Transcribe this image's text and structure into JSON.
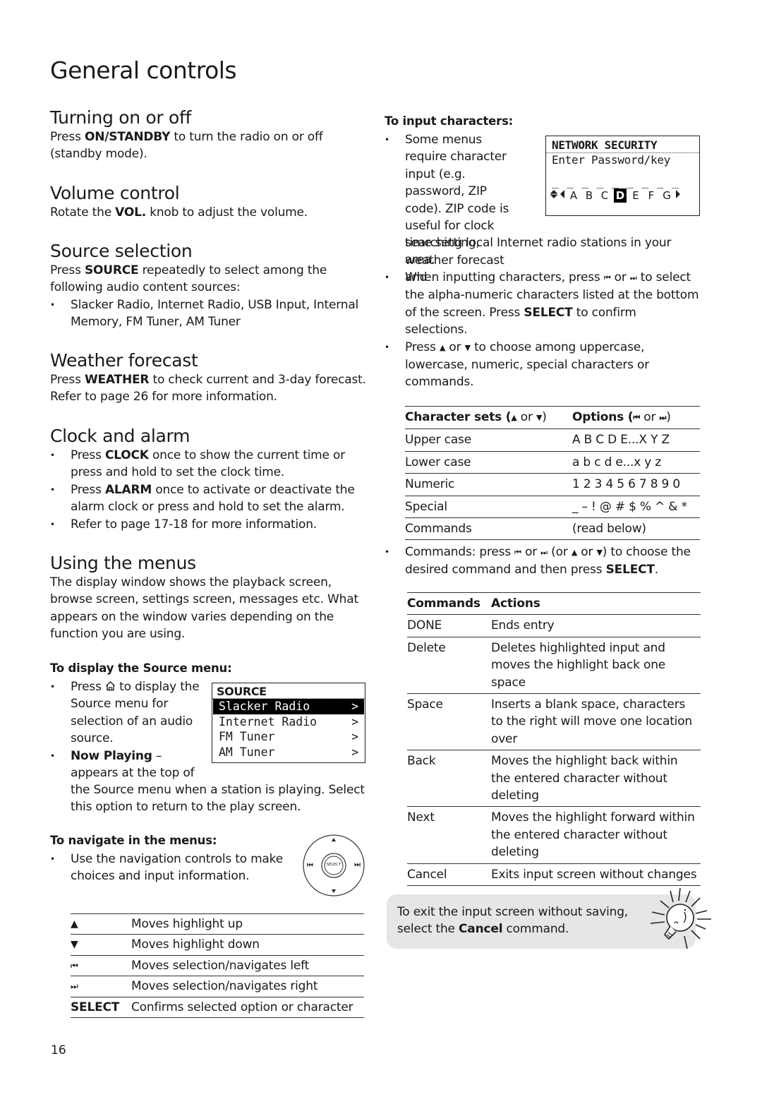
{
  "page": {
    "title": "General controls",
    "page_number": "16"
  },
  "left": {
    "turning": {
      "heading": "Turning on or off",
      "pre": "Press ",
      "key": "ON/STANDBY",
      "post": " to turn the radio on or off (standby mode)."
    },
    "volume": {
      "heading": "Volume control",
      "pre": "Rotate the ",
      "key": "VOL.",
      "post": " knob to adjust the volume."
    },
    "source": {
      "heading": "Source selection",
      "pre": "Press ",
      "key": "SOURCE",
      "post": " repeatedly to select among the following audio content sources:",
      "bullet": "Slacker Radio, Internet Radio, USB Input, Internal Memory, FM Tuner, AM Tuner"
    },
    "weather": {
      "heading": "Weather forecast",
      "pre": "Press ",
      "key": "WEATHER",
      "post": " to check current and 3-day forecast. Refer to page 26 for more information."
    },
    "clock": {
      "heading": "Clock and alarm",
      "bullets": [
        {
          "pre": "Press ",
          "key": "CLOCK",
          "post": " once to show the current time or press and hold to set the clock time."
        },
        {
          "pre": "Press ",
          "key": "ALARM",
          "post": " once to activate or deactivate the alarm clock or press and hold to set the alarm."
        },
        {
          "pre": "Refer to page 17-18 for more information.",
          "key": "",
          "post": ""
        }
      ]
    },
    "menus": {
      "heading": "Using the menus",
      "body": "The display window shows the playback screen, browse screen, settings screen, messages etc. What appears on the window varies depending on the function you are using.",
      "source_menu_heading": "To display the Source menu:",
      "source_bullet_pre": "Press ",
      "source_bullet_post": " to display the Source menu for selection of an audio source.",
      "now_playing_key": "Now Playing",
      "now_playing_text": " – appears at the top of the Source menu when a station is playing. Select this option to return to the play screen.",
      "lcd": {
        "title": "SOURCE",
        "items": [
          {
            "label": "Slacker Radio",
            "arrow": ">",
            "selected": true
          },
          {
            "label": "Internet Radio",
            "arrow": ">",
            "selected": false
          },
          {
            "label": "FM Tuner",
            "arrow": ">",
            "selected": false
          },
          {
            "label": "AM Tuner",
            "arrow": ">",
            "selected": false
          }
        ]
      },
      "navigate_heading": "To navigate in the menus:",
      "navigate_bullet": "Use the navigation controls to make choices and input information.",
      "dial_center_label": "SELECT",
      "controls": [
        {
          "key": "▲",
          "icon": "up-triangle-icon",
          "action": "Moves highlight up"
        },
        {
          "key": "▼",
          "icon": "down-triangle-icon",
          "action": "Moves highlight down"
        },
        {
          "key": "⏮",
          "icon": "skip-back-icon",
          "action": "Moves selection/navigates left"
        },
        {
          "key": "⏭",
          "icon": "skip-forward-icon",
          "action": "Moves selection/navigates right"
        },
        {
          "key": "SELECT",
          "icon": "",
          "action": "Confirms selected option or character"
        }
      ]
    }
  },
  "right": {
    "input_heading": "To input characters:",
    "bullet1": "Some menus require character input (e.g. password, ZIP code). ZIP code is useful for clock time setting, weather forecast and searching local Internet radio stations in your area.",
    "lcd": {
      "title": "NETWORK SECURITY",
      "line2": "Enter Password/key",
      "blanks": "_ _ _ _ _ _ _ _ _",
      "chars": [
        "A",
        "B",
        "C",
        "D",
        "E",
        "F",
        "G"
      ],
      "selected_char": "D"
    },
    "bullet2_pre": "When inputting characters, press ",
    "bullet2_mid": " or ",
    "bullet2_post": " to select the alpha-numeric characters listed at the bottom of the screen. Press ",
    "bullet2_key": "SELECT",
    "bullet2_end": " to confirm selections.",
    "bullet3_pre": "Press ",
    "bullet3_mid": " or ",
    "bullet3_post": " to choose among uppercase, lowercase, numeric, special characters or commands.",
    "charsets": {
      "header_col1": "Character sets (",
      "header_col1_or": " or ",
      "header_col2": "Options (",
      "header_col2_or": " or ",
      "rows": [
        {
          "set": "Upper case",
          "options": "A B C D E...X Y Z"
        },
        {
          "set": "Lower case",
          "options": "a b c d e...x y z"
        },
        {
          "set": "Numeric",
          "options": "1 2 3 4 5 6 7 8 9 0"
        },
        {
          "set": "Special",
          "options": "_ – ! @ # $ % ^ & *"
        },
        {
          "set": "Commands",
          "options": "(read below)"
        }
      ]
    },
    "commands_bullet_pre": "Commands: press ",
    "commands_bullet_mid1": " or ",
    "commands_bullet_mid2": " (or ",
    "commands_bullet_mid3": " or ",
    "commands_bullet_post": ") to choose the desired command and then press ",
    "commands_bullet_key": "SELECT",
    "commands_bullet_end": ".",
    "commands": {
      "header_col1": "Commands",
      "header_col2": "Actions",
      "rows": [
        {
          "command": "DONE",
          "action": "Ends entry"
        },
        {
          "command": "Delete",
          "action": "Deletes highlighted input and moves the highlight back one space"
        },
        {
          "command": "Space",
          "action": "Inserts a blank space, characters to the right will move one location over"
        },
        {
          "command": "Back",
          "action": "Moves the highlight back within the entered character without deleting"
        },
        {
          "command": "Next",
          "action": "Moves the highlight forward within the entered character without deleting"
        },
        {
          "command": "Cancel",
          "action": "Exits input screen without changes"
        }
      ]
    },
    "tip": {
      "pre": "To exit the input screen without saving, select the ",
      "key": "Cancel",
      "post": " command."
    }
  }
}
